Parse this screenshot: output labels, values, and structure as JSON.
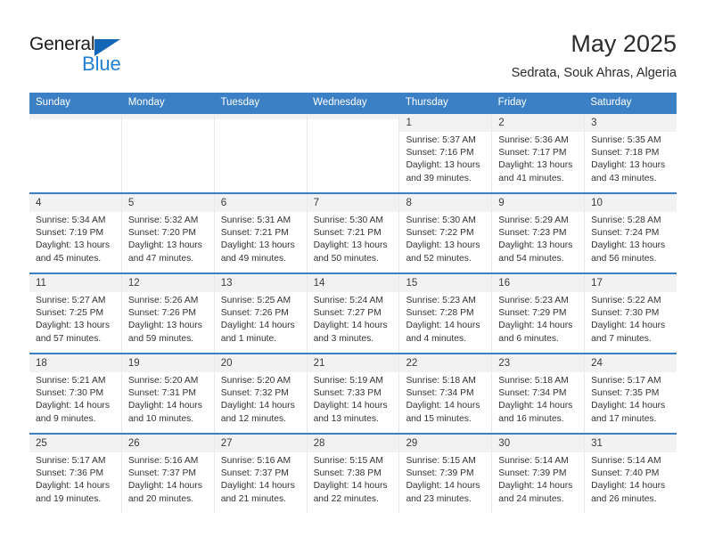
{
  "logo": {
    "word_top": "General",
    "word_bottom": "Blue",
    "triangle_color": "#1266b5",
    "blue_color": "#1f7fd4"
  },
  "header": {
    "title": "May 2025",
    "subtitle": "Sedrata, Souk Ahras, Algeria"
  },
  "theme": {
    "header_row_bg": "#3b80c4",
    "day_number_bg": "#f2f2f2",
    "cell_bg": "#ffffff",
    "text_color": "#333333"
  },
  "weekdays": [
    "Sunday",
    "Monday",
    "Tuesday",
    "Wednesday",
    "Thursday",
    "Friday",
    "Saturday"
  ],
  "weeks": [
    {
      "days": [
        {
          "number": "",
          "empty": true,
          "sunrise": "",
          "sunset": "",
          "daylight_1": "",
          "daylight_2": ""
        },
        {
          "number": "",
          "empty": true,
          "sunrise": "",
          "sunset": "",
          "daylight_1": "",
          "daylight_2": ""
        },
        {
          "number": "",
          "empty": true,
          "sunrise": "",
          "sunset": "",
          "daylight_1": "",
          "daylight_2": ""
        },
        {
          "number": "",
          "empty": true,
          "sunrise": "",
          "sunset": "",
          "daylight_1": "",
          "daylight_2": ""
        },
        {
          "number": "1",
          "sunrise": "Sunrise: 5:37 AM",
          "sunset": "Sunset: 7:16 PM",
          "daylight_1": "Daylight: 13 hours",
          "daylight_2": "and 39 minutes."
        },
        {
          "number": "2",
          "sunrise": "Sunrise: 5:36 AM",
          "sunset": "Sunset: 7:17 PM",
          "daylight_1": "Daylight: 13 hours",
          "daylight_2": "and 41 minutes."
        },
        {
          "number": "3",
          "sunrise": "Sunrise: 5:35 AM",
          "sunset": "Sunset: 7:18 PM",
          "daylight_1": "Daylight: 13 hours",
          "daylight_2": "and 43 minutes."
        }
      ]
    },
    {
      "days": [
        {
          "number": "4",
          "sunrise": "Sunrise: 5:34 AM",
          "sunset": "Sunset: 7:19 PM",
          "daylight_1": "Daylight: 13 hours",
          "daylight_2": "and 45 minutes."
        },
        {
          "number": "5",
          "sunrise": "Sunrise: 5:32 AM",
          "sunset": "Sunset: 7:20 PM",
          "daylight_1": "Daylight: 13 hours",
          "daylight_2": "and 47 minutes."
        },
        {
          "number": "6",
          "sunrise": "Sunrise: 5:31 AM",
          "sunset": "Sunset: 7:21 PM",
          "daylight_1": "Daylight: 13 hours",
          "daylight_2": "and 49 minutes."
        },
        {
          "number": "7",
          "sunrise": "Sunrise: 5:30 AM",
          "sunset": "Sunset: 7:21 PM",
          "daylight_1": "Daylight: 13 hours",
          "daylight_2": "and 50 minutes."
        },
        {
          "number": "8",
          "sunrise": "Sunrise: 5:30 AM",
          "sunset": "Sunset: 7:22 PM",
          "daylight_1": "Daylight: 13 hours",
          "daylight_2": "and 52 minutes."
        },
        {
          "number": "9",
          "sunrise": "Sunrise: 5:29 AM",
          "sunset": "Sunset: 7:23 PM",
          "daylight_1": "Daylight: 13 hours",
          "daylight_2": "and 54 minutes."
        },
        {
          "number": "10",
          "sunrise": "Sunrise: 5:28 AM",
          "sunset": "Sunset: 7:24 PM",
          "daylight_1": "Daylight: 13 hours",
          "daylight_2": "and 56 minutes."
        }
      ]
    },
    {
      "days": [
        {
          "number": "11",
          "sunrise": "Sunrise: 5:27 AM",
          "sunset": "Sunset: 7:25 PM",
          "daylight_1": "Daylight: 13 hours",
          "daylight_2": "and 57 minutes."
        },
        {
          "number": "12",
          "sunrise": "Sunrise: 5:26 AM",
          "sunset": "Sunset: 7:26 PM",
          "daylight_1": "Daylight: 13 hours",
          "daylight_2": "and 59 minutes."
        },
        {
          "number": "13",
          "sunrise": "Sunrise: 5:25 AM",
          "sunset": "Sunset: 7:26 PM",
          "daylight_1": "Daylight: 14 hours",
          "daylight_2": "and 1 minute."
        },
        {
          "number": "14",
          "sunrise": "Sunrise: 5:24 AM",
          "sunset": "Sunset: 7:27 PM",
          "daylight_1": "Daylight: 14 hours",
          "daylight_2": "and 3 minutes."
        },
        {
          "number": "15",
          "sunrise": "Sunrise: 5:23 AM",
          "sunset": "Sunset: 7:28 PM",
          "daylight_1": "Daylight: 14 hours",
          "daylight_2": "and 4 minutes."
        },
        {
          "number": "16",
          "sunrise": "Sunrise: 5:23 AM",
          "sunset": "Sunset: 7:29 PM",
          "daylight_1": "Daylight: 14 hours",
          "daylight_2": "and 6 minutes."
        },
        {
          "number": "17",
          "sunrise": "Sunrise: 5:22 AM",
          "sunset": "Sunset: 7:30 PM",
          "daylight_1": "Daylight: 14 hours",
          "daylight_2": "and 7 minutes."
        }
      ]
    },
    {
      "days": [
        {
          "number": "18",
          "sunrise": "Sunrise: 5:21 AM",
          "sunset": "Sunset: 7:30 PM",
          "daylight_1": "Daylight: 14 hours",
          "daylight_2": "and 9 minutes."
        },
        {
          "number": "19",
          "sunrise": "Sunrise: 5:20 AM",
          "sunset": "Sunset: 7:31 PM",
          "daylight_1": "Daylight: 14 hours",
          "daylight_2": "and 10 minutes."
        },
        {
          "number": "20",
          "sunrise": "Sunrise: 5:20 AM",
          "sunset": "Sunset: 7:32 PM",
          "daylight_1": "Daylight: 14 hours",
          "daylight_2": "and 12 minutes."
        },
        {
          "number": "21",
          "sunrise": "Sunrise: 5:19 AM",
          "sunset": "Sunset: 7:33 PM",
          "daylight_1": "Daylight: 14 hours",
          "daylight_2": "and 13 minutes."
        },
        {
          "number": "22",
          "sunrise": "Sunrise: 5:18 AM",
          "sunset": "Sunset: 7:34 PM",
          "daylight_1": "Daylight: 14 hours",
          "daylight_2": "and 15 minutes."
        },
        {
          "number": "23",
          "sunrise": "Sunrise: 5:18 AM",
          "sunset": "Sunset: 7:34 PM",
          "daylight_1": "Daylight: 14 hours",
          "daylight_2": "and 16 minutes."
        },
        {
          "number": "24",
          "sunrise": "Sunrise: 5:17 AM",
          "sunset": "Sunset: 7:35 PM",
          "daylight_1": "Daylight: 14 hours",
          "daylight_2": "and 17 minutes."
        }
      ]
    },
    {
      "days": [
        {
          "number": "25",
          "sunrise": "Sunrise: 5:17 AM",
          "sunset": "Sunset: 7:36 PM",
          "daylight_1": "Daylight: 14 hours",
          "daylight_2": "and 19 minutes."
        },
        {
          "number": "26",
          "sunrise": "Sunrise: 5:16 AM",
          "sunset": "Sunset: 7:37 PM",
          "daylight_1": "Daylight: 14 hours",
          "daylight_2": "and 20 minutes."
        },
        {
          "number": "27",
          "sunrise": "Sunrise: 5:16 AM",
          "sunset": "Sunset: 7:37 PM",
          "daylight_1": "Daylight: 14 hours",
          "daylight_2": "and 21 minutes."
        },
        {
          "number": "28",
          "sunrise": "Sunrise: 5:15 AM",
          "sunset": "Sunset: 7:38 PM",
          "daylight_1": "Daylight: 14 hours",
          "daylight_2": "and 22 minutes."
        },
        {
          "number": "29",
          "sunrise": "Sunrise: 5:15 AM",
          "sunset": "Sunset: 7:39 PM",
          "daylight_1": "Daylight: 14 hours",
          "daylight_2": "and 23 minutes."
        },
        {
          "number": "30",
          "sunrise": "Sunrise: 5:14 AM",
          "sunset": "Sunset: 7:39 PM",
          "daylight_1": "Daylight: 14 hours",
          "daylight_2": "and 24 minutes."
        },
        {
          "number": "31",
          "sunrise": "Sunrise: 5:14 AM",
          "sunset": "Sunset: 7:40 PM",
          "daylight_1": "Daylight: 14 hours",
          "daylight_2": "and 26 minutes."
        }
      ]
    }
  ]
}
